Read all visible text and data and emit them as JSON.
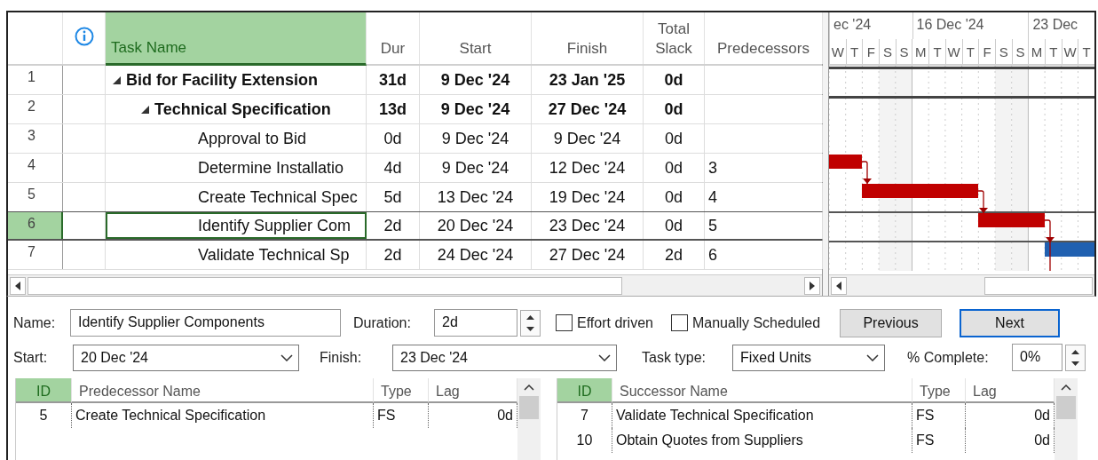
{
  "table": {
    "columns": [
      {
        "label": "Task Name",
        "selected": true
      },
      {
        "label": "Dur",
        "selected": false
      },
      {
        "label": "Start",
        "selected": false
      },
      {
        "label": "Finish",
        "selected": false
      },
      {
        "label": "Total Slack",
        "selected": false
      },
      {
        "label": "Predecessors",
        "selected": false
      }
    ],
    "rows": [
      {
        "id": "1",
        "name": "Bid for Facility Extension",
        "dur": "31d",
        "start": "9 Dec '24",
        "finish": "23 Jan '25",
        "total_slack": "0d",
        "summary": true,
        "expanded": true,
        "selected": false,
        "bar": {
          "kind": "summary"
        },
        "children": [
          {
            "id": "2",
            "name": "Technical Specification",
            "dur": "13d",
            "start": "9 Dec '24",
            "finish": "27 Dec '24",
            "total_slack": "0d",
            "summary": true,
            "expanded": true,
            "selected": false,
            "bar": {
              "kind": "summary"
            },
            "children": [
              {
                "id": "3",
                "name": "Approval to Bid",
                "dur": "0d",
                "start": "9 Dec '24",
                "finish": "9 Dec '24",
                "total_slack": "0d",
                "summary": false,
                "selected": false
              },
              {
                "id": "4",
                "name": "Determine Installatio",
                "dur": "4d",
                "start": "9 Dec '24",
                "finish": "12 Dec '24",
                "total_slack": "0d",
                "predecessors": "3",
                "summary": false,
                "selected": false,
                "bar": {
                  "kind": "critical"
                }
              },
              {
                "id": "5",
                "name": "Create Technical Spec",
                "dur": "5d",
                "start": "13 Dec '24",
                "finish": "19 Dec '24",
                "total_slack": "0d",
                "predecessors": "4",
                "summary": false,
                "selected": false,
                "bar": {
                  "kind": "critical"
                }
              },
              {
                "id": "6",
                "name": "Identify Supplier Com",
                "dur": "2d",
                "start": "20 Dec '24",
                "finish": "23 Dec '24",
                "total_slack": "0d",
                "predecessors": "5",
                "summary": false,
                "selected": true,
                "bar": {
                  "kind": "critical"
                }
              },
              {
                "id": "7",
                "name": "Validate Technical Sp",
                "dur": "2d",
                "start": "24 Dec '24",
                "finish": "27 Dec '24",
                "total_slack": "2d",
                "predecessors": "6",
                "summary": false,
                "selected": false,
                "bar": {
                  "kind": "normal"
                }
              }
            ]
          }
        ]
      }
    ]
  },
  "gantt": {
    "weeks": [
      "ec '24",
      "16 Dec '24",
      "23 Dec"
    ],
    "days": [
      "W",
      "T",
      "F",
      "S",
      "S",
      "M",
      "T",
      "W",
      "T",
      "F",
      "S",
      "S",
      "M",
      "T",
      "W",
      "T"
    ]
  },
  "form": {
    "name_label": "Name:",
    "name": "Identify Supplier Components",
    "duration_label": "Duration:",
    "duration": "2d",
    "effort_driven": {
      "label": "Effort driven",
      "checked": false
    },
    "manually_scheduled": {
      "label": "Manually Scheduled",
      "checked": false
    },
    "buttons": [
      {
        "label": "Previous",
        "focused": false
      },
      {
        "label": "Next",
        "focused": true
      }
    ],
    "start_label": "Start:",
    "start": "20 Dec '24",
    "finish_label": "Finish:",
    "finish": "23 Dec '24",
    "task_type_label": "Task type:",
    "task_type": "Fixed Units",
    "complete_label": "% Complete:",
    "complete": "0%"
  },
  "predecessor_table": {
    "columns": [
      "ID",
      "Predecessor Name",
      "Type",
      "Lag"
    ],
    "rows": [
      {
        "id": "5",
        "name": "Create Technical Specification",
        "type": "FS",
        "lag": "0d"
      }
    ]
  },
  "successor_table": {
    "columns": [
      "ID",
      "Successor Name",
      "Type",
      "Lag"
    ],
    "rows": [
      {
        "id": "7",
        "name": "Validate Technical Specification",
        "type": "FS",
        "lag": "0d"
      },
      {
        "id": "10",
        "name": "Obtain Quotes from Suppliers",
        "type": "FS",
        "lag": "0d"
      }
    ]
  }
}
